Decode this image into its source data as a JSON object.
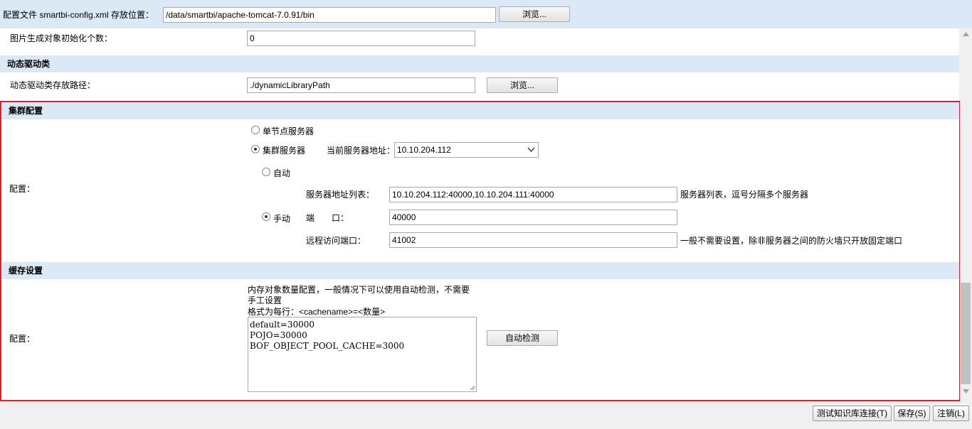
{
  "config_file": {
    "label": "配置文件 smartbi-config.xml 存放位置：",
    "path": "/data/smartbi/apache-tomcat-7.0.91/bin",
    "browse_label": "浏览..."
  },
  "image_gen": {
    "label": "图片生成对象初始化个数：",
    "value": "0"
  },
  "dynamic_driver": {
    "section_title": "动态驱动类",
    "label": "动态驱动类存放路径：",
    "path": "./dynamicLibraryPath",
    "browse_label": "浏览..."
  },
  "cluster": {
    "section_title": "集群配置",
    "config_label": "配置：",
    "single_node_label": "单节点服务器",
    "cluster_label": "集群服务器",
    "current_server_label": "当前服务器地址：",
    "current_server_value": "10.10.204.112",
    "auto_label": "自动",
    "manual_label": "手动",
    "server_list_label": "服务器地址列表：",
    "server_list_value": "10.10.204.112:40000,10.10.204.111:40000",
    "server_list_hint": "服务器列表，逗号分隔多个服务器",
    "port_label_a": "端",
    "port_label_b": "口：",
    "port_value": "40000",
    "remote_port_label": "远程访问端口：",
    "remote_port_value": "41002",
    "remote_port_hint": "一般不需要设置，除非服务器之间的防火墙只开放固定端口",
    "mode": "cluster",
    "address_mode": "manual"
  },
  "cache": {
    "section_title": "缓存设置",
    "config_label": "配置：",
    "desc_line1": "内存对象数量配置，一般情况下可以使用自动检测，不需要",
    "desc_line2": "手工设置",
    "desc_line3": "格式为每行：<cachename>=<数量>",
    "text": "default=30000\nPOJO=30000\nBOF_OBJECT_POOL_CACHE=3000",
    "auto_detect_label": "自动检测"
  },
  "footer": {
    "test_label": "测试知识库连接(T)",
    "save_label": "保存(S)",
    "cancel_label": "注销(L)"
  },
  "colors": {
    "section_bg": "#dbe8f5",
    "highlight_border": "#e31e24"
  }
}
